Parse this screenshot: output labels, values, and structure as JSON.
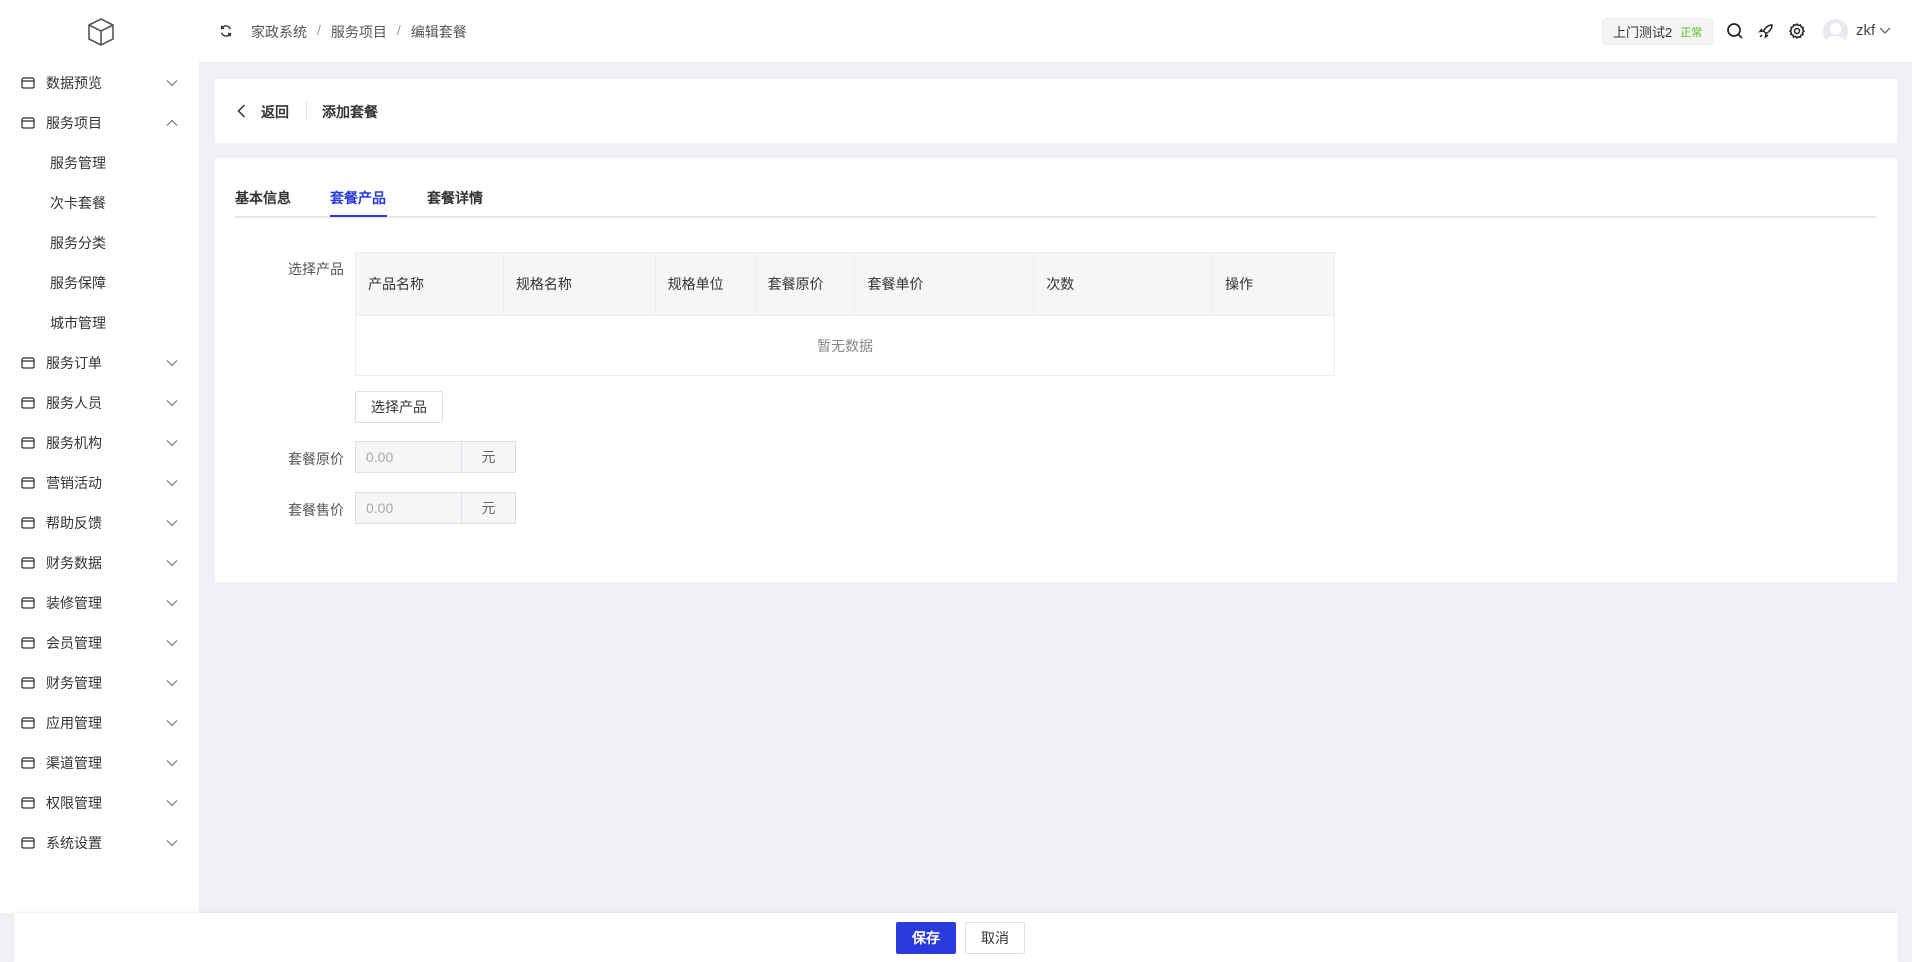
{
  "sidebar": {
    "items": [
      {
        "label": "数据预览",
        "icon": "chart-icon",
        "expanded": false
      },
      {
        "label": "服务项目",
        "icon": "card-icon",
        "expanded": true,
        "children": [
          "服务管理",
          "次卡套餐",
          "服务分类",
          "服务保障",
          "城市管理"
        ]
      },
      {
        "label": "服务订单",
        "icon": "order-icon"
      },
      {
        "label": "服务人员",
        "icon": "user-icon"
      },
      {
        "label": "服务机构",
        "icon": "org-icon"
      },
      {
        "label": "营销活动",
        "icon": "marketing-icon"
      },
      {
        "label": "帮助反馈",
        "icon": "feedback-icon"
      },
      {
        "label": "财务数据",
        "icon": "finance-icon"
      },
      {
        "label": "装修管理",
        "icon": "decor-icon"
      },
      {
        "label": "会员管理",
        "icon": "member-icon"
      },
      {
        "label": "财务管理",
        "icon": "finance-manage-icon"
      },
      {
        "label": "应用管理",
        "icon": "app-icon"
      },
      {
        "label": "渠道管理",
        "icon": "channel-icon"
      },
      {
        "label": "权限管理",
        "icon": "lock-icon"
      },
      {
        "label": "系统设置",
        "icon": "gear-icon"
      }
    ]
  },
  "header": {
    "breadcrumb": [
      "家政系统",
      "服务项目",
      "编辑套餐"
    ],
    "tenant": "上门测试2",
    "tenant_status": "正常",
    "username": "zkf"
  },
  "page": {
    "back": "返回",
    "title": "添加套餐"
  },
  "tabs": [
    "基本信息",
    "套餐产品",
    "套餐详情"
  ],
  "form": {
    "select_label": "选择产品",
    "columns": [
      "产品名称",
      "规格名称",
      "规格单位",
      "套餐原价",
      "套餐单价",
      "次数",
      "操作"
    ],
    "empty": "暂无数据",
    "select_button": "选择产品",
    "original_price_label": "套餐原价",
    "original_price": "0.00",
    "sale_price_label": "套餐售价",
    "sale_price": "0.00",
    "unit": "元"
  },
  "footer": {
    "save": "保存",
    "cancel": "取消"
  },
  "colors": {
    "primary": "#2a3bde",
    "status": "#52c41a"
  }
}
